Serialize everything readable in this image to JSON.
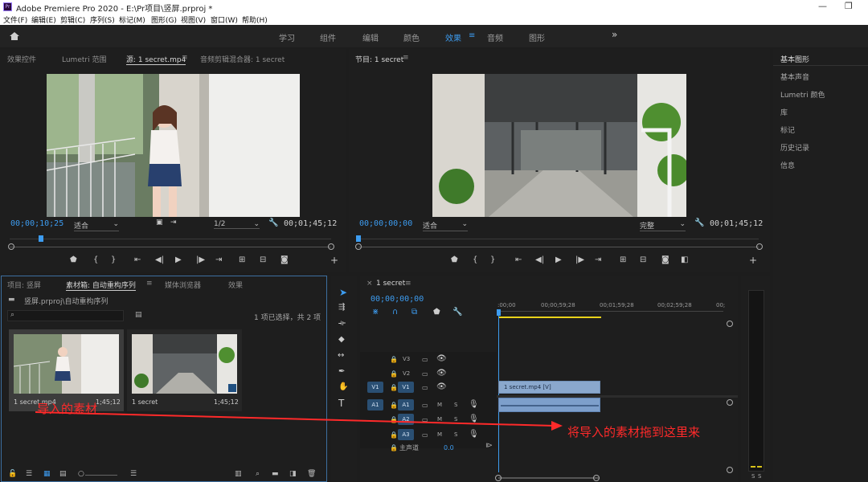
{
  "titlebar": {
    "title": "Adobe Premiere Pro 2020 - E:\\Pr项目\\竖屏.prproj *",
    "logo": "Pr",
    "min": "—",
    "restore": "❐"
  },
  "menu": [
    "文件(F)",
    "编辑(E)",
    "剪辑(C)",
    "序列(S)",
    "标记(M)",
    "图形(G)",
    "视图(V)",
    "窗口(W)",
    "帮助(H)"
  ],
  "workspaces": [
    "学习",
    "组件",
    "编辑",
    "颜色",
    "效果",
    "音频",
    "图形"
  ],
  "workspace_active_index": 4,
  "workspace_more": "»",
  "source_panel": {
    "tabs": [
      "效果控件",
      "Lumetri 范围",
      "源: 1 secret.mp4",
      "音频剪辑混合器: 1 secret"
    ],
    "timecode": "00;00;10;25",
    "fit": "适合",
    "resolution": "1/2",
    "duration": "00;01;45;12"
  },
  "program_panel": {
    "tab": "节目: 1 secret",
    "timecode": "00;00;00;00",
    "fit": "适合",
    "quality": "完整",
    "duration": "00;01;45;12"
  },
  "right_panel": {
    "items": [
      "基本图形",
      "基本声音",
      "Lumetri 颜色",
      "库",
      "标记",
      "历史记录",
      "信息"
    ]
  },
  "project_panel": {
    "tabs": [
      "项目: 竖屏",
      "素材箱: 自动重构序列",
      "媒体浏览器",
      "效果"
    ],
    "path": "竖屏.prproj\\自动重构序列",
    "selection_status": "1 项已选择，共 2 项",
    "clips": [
      {
        "name": "1 secret.mp4",
        "duration": "1;45;12"
      },
      {
        "name": "1 secret",
        "duration": "1;45;12"
      }
    ]
  },
  "timeline": {
    "tab": "1 secret",
    "timecode": "00;00;00;00",
    "ruler": [
      ":00;00",
      "00;00;59;28",
      "00;01;59;28",
      "00;02;59;28",
      "00;"
    ],
    "video_tracks": [
      "V3",
      "V2",
      "V1"
    ],
    "audio_tracks": [
      "A1",
      "A2",
      "A3"
    ],
    "source_v": "V1",
    "source_a": "A1",
    "master": "主声道",
    "master_value": "0.0",
    "clip_label": "1 secret.mp4 [V]",
    "track_m": "M",
    "track_s": "S"
  },
  "meter": {
    "labels": [
      "S",
      "S"
    ]
  },
  "annotations": {
    "left": "导入的素材",
    "right": "将导入的素材拖到这里来",
    "color": "#ff2a2a"
  }
}
